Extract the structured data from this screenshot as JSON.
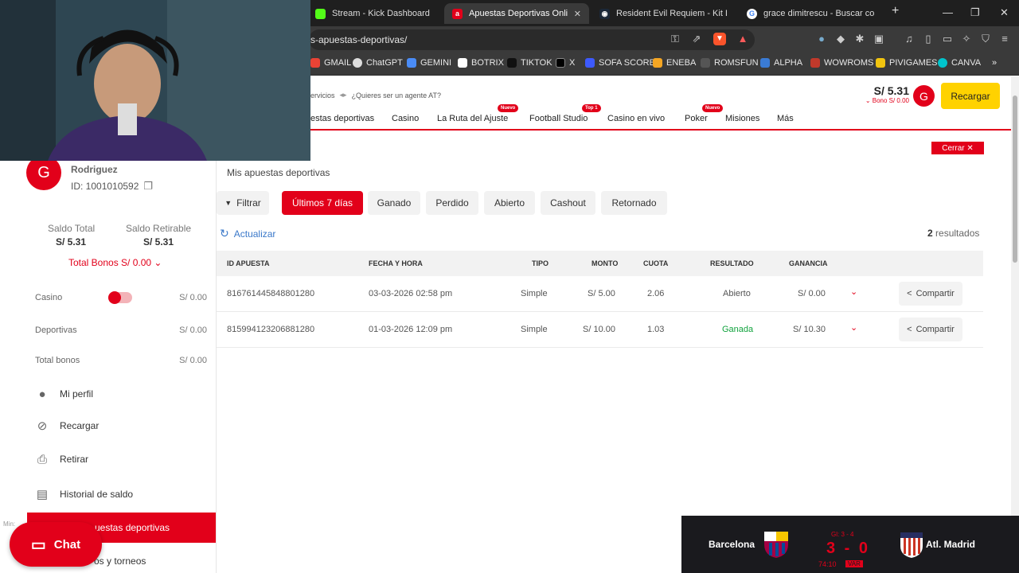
{
  "browser": {
    "tabs": [
      {
        "title": "Stream - Kick Dashboard",
        "active": false
      },
      {
        "title": "Apuestas Deportivas Online |",
        "active": true
      },
      {
        "title": "Resident Evil Requiem - Kit Deluxe",
        "active": false
      },
      {
        "title": "grace dimitrescu - Buscar con Goo",
        "active": false
      }
    ],
    "new_tab": "+",
    "url": "s-apuestas-deportivas/",
    "bookmarks": [
      "GMAIL",
      "ChatGPT",
      "GEMINI",
      "BOTRIX",
      "TIKTOK",
      "X",
      "SOFA SCORE",
      "ENEBA",
      "ROMSFUN",
      "ALPHA",
      "WOWROMS",
      "PIVIGAMES",
      "CANVA"
    ],
    "more_bookmarks": "»"
  },
  "header": {
    "util_text": "ervicios",
    "util_link": "¿Quieres ser un agente AT?",
    "nav": [
      {
        "label": "estas deportivas",
        "badge": ""
      },
      {
        "label": "Casino",
        "badge": ""
      },
      {
        "label": "La Ruta del Ajuste",
        "badge": "Nuevo"
      },
      {
        "label": "Football Studio",
        "badge": "Top 1"
      },
      {
        "label": "Casino en vivo",
        "badge": ""
      },
      {
        "label": "Poker",
        "badge": "Nuevo"
      },
      {
        "label": "Misiones",
        "badge": ""
      },
      {
        "label": "Más",
        "badge": ""
      }
    ],
    "balance": "S/ 5.31",
    "bono": "⌄ Bono S/ 0.00",
    "avatar_letter": "G",
    "recargar": "Recargar",
    "cerrar": "Cerrar ✕"
  },
  "sidebar": {
    "avatar_letter": "G",
    "name": "Rodriguez",
    "id": "ID: 1001010592",
    "saldo_total_label": "Saldo Total",
    "saldo_total": "S/ 5.31",
    "saldo_retirable_label": "Saldo Retirable",
    "saldo_retirable": "S/ 5.31",
    "total_bonos": "Total Bonos S/ 0.00 ⌄",
    "rows": [
      {
        "label": "Casino",
        "value": "S/ 0.00"
      },
      {
        "label": "Deportivas",
        "value": "S/ 0.00"
      },
      {
        "label": "Total bonos",
        "value": "S/ 0.00"
      }
    ],
    "menu": [
      {
        "label": "Mi perfil",
        "icon": "user-icon"
      },
      {
        "label": "Recargar",
        "icon": "recharge-icon"
      },
      {
        "label": "Retirar",
        "icon": "withdraw-icon"
      },
      {
        "label": "Historial de saldo",
        "icon": "wallet-icon"
      }
    ],
    "active_menu": "uestas deportivas",
    "torneos": "os y torneos",
    "chat": "Chat",
    "lim": "Min:"
  },
  "main": {
    "title": "Mis apuestas deportivas",
    "filters": [
      "Filtrar",
      "Últimos 7 días",
      "Ganado",
      "Perdido",
      "Abierto",
      "Cashout",
      "Retornado"
    ],
    "active_filter": "Últimos 7 días",
    "actualizar": "Actualizar",
    "results_count": "2",
    "results_label": "resultados",
    "columns": [
      "ID APUESTA",
      "FECHA Y HORA",
      "TIPO",
      "MONTO",
      "CUOTA",
      "RESULTADO",
      "GANANCIA"
    ],
    "rows": [
      {
        "id": "816761445848801280",
        "fecha": "03-03-2026 02:58 pm",
        "tipo": "Simple",
        "monto": "S/ 5.00",
        "cuota": "2.06",
        "resultado": "Abierto",
        "ganancia": "S/ 0.00",
        "share": "Compartir"
      },
      {
        "id": "815994123206881280",
        "fecha": "01-03-2026 12:09 pm",
        "tipo": "Simple",
        "monto": "S/ 10.00",
        "cuota": "1.03",
        "resultado": "Ganada",
        "ganancia": "S/ 10.30",
        "share": "Compartir"
      }
    ]
  },
  "scoreboard": {
    "home": "Barcelona",
    "away": "Atl. Madrid",
    "score": "3 - 0",
    "global": "Gl: 3 - 4",
    "time": "74:10",
    "var": "VAR"
  },
  "colors": {
    "brand_red": "#e2001a",
    "recargar_yellow": "#ffd200",
    "win_green": "#12a33e"
  }
}
